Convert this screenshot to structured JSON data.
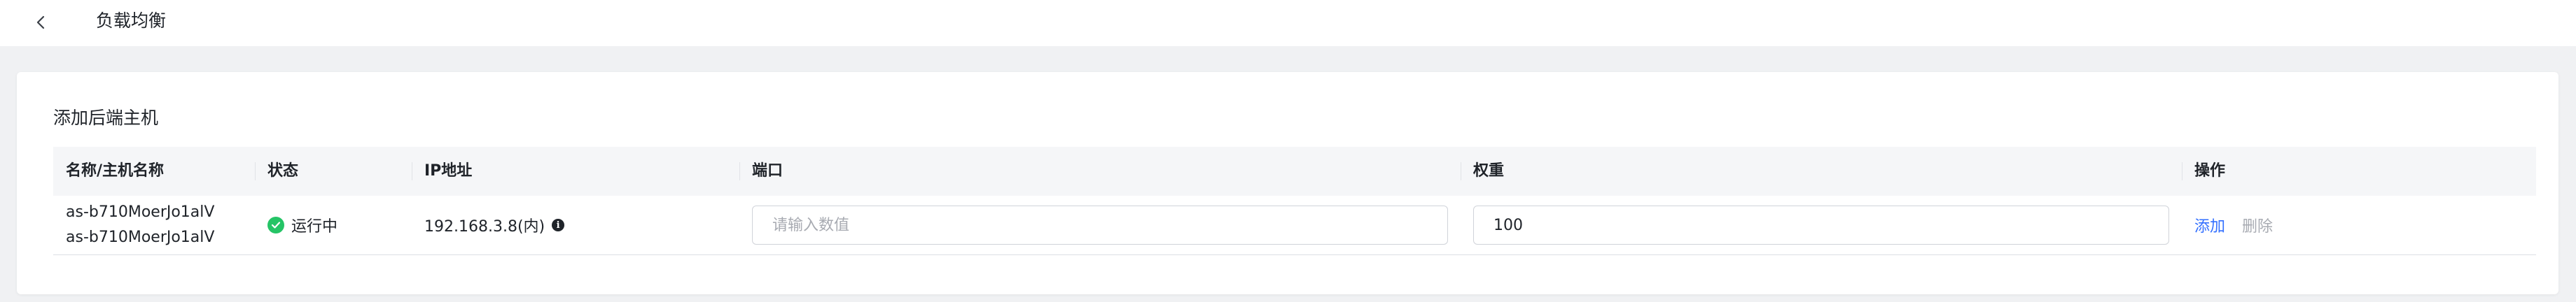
{
  "header": {
    "title": "负载均衡"
  },
  "section": {
    "title": "添加后端主机"
  },
  "table": {
    "columns": [
      "名称/主机名称",
      "状态",
      "IP地址",
      "端口",
      "权重",
      "操作"
    ],
    "rows": [
      {
        "name": "as-b710MoerJo1alV",
        "hostname": "as-b710MoerJo1alV",
        "status": "运行中",
        "ip": "192.168.3.8(内)",
        "port_placeholder": "请输入数值",
        "port_value": "",
        "weight_value": "100",
        "actions": {
          "add": "添加",
          "delete": "删除"
        }
      }
    ]
  },
  "colors": {
    "accent": "#3370ff",
    "status_running": "#25c466",
    "disabled": "#a8abb2"
  }
}
